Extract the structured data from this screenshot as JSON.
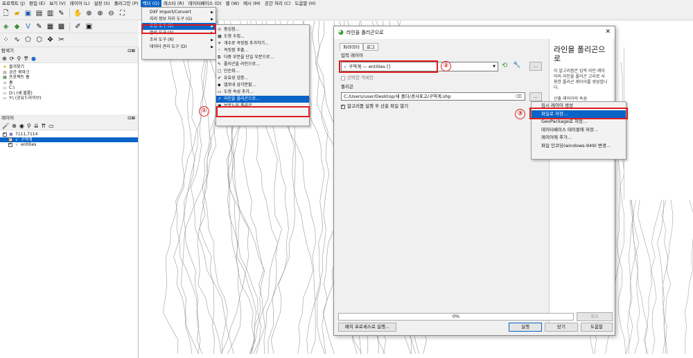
{
  "menubar": [
    "프로젝트 (J)",
    "편집 (E)",
    "보기 (V)",
    "레이어 (L)",
    "설정 (S)",
    "플러그인 (P)",
    "벡터 (O)",
    "래스터 (R)",
    "데이터베이스 (D)",
    "웹 (W)",
    "메시 (M)",
    "공간 처리 (C)",
    "도움말 (H)"
  ],
  "menubar_active_index": 6,
  "vector_menu": {
    "items": [
      {
        "label": "DXF Import/Convert",
        "submenu": true
      },
      {
        "label": "지리 정보 처리 도구 (G)",
        "submenu": true
      },
      {
        "label": "도형 도구 (E)",
        "submenu": true,
        "selected": true
      },
      {
        "label": "분석 도구 (A)",
        "submenu": true
      },
      {
        "label": "조사 도구 (R)",
        "submenu": true
      },
      {
        "label": "데이터 관리 도구 (D)",
        "submenu": true
      }
    ]
  },
  "geometry_menu": {
    "items": [
      {
        "label": "중심점...",
        "icon": "centroid-icon",
        "glyph": "⊙"
      },
      {
        "label": "도형 수집...",
        "icon": "collect-icon",
        "glyph": "▦"
      },
      {
        "label": "개수로 꼭짓점 추가하기...",
        "icon": "densify-icon",
        "glyph": "✳"
      },
      {
        "label": "꼭짓점 추출...",
        "icon": "vertices-icon",
        "glyph": "⁘"
      },
      {
        "label": "다중 부분을 단일 부분으로...",
        "icon": "multipart-icon",
        "glyph": "⧉"
      },
      {
        "label": "폴리곤을 라인으로...",
        "icon": "polygon-to-line-icon",
        "glyph": "✎"
      },
      {
        "label": "단순화...",
        "icon": "simplify-icon",
        "glyph": "▢"
      },
      {
        "label": "유효성 검증...",
        "icon": "check-icon",
        "glyph": "✔"
      },
      {
        "label": "델로네 삼각분할...",
        "icon": "delaunay-icon",
        "glyph": "◆"
      },
      {
        "label": "도형 속성 추가...",
        "icon": "geometry-attr-icon",
        "glyph": "▭"
      },
      {
        "label": "라인을 폴리곤으로...",
        "icon": "line-to-polygon-icon",
        "glyph": "↗",
        "selected": true
      },
      {
        "label": "보로노이 폴리곤...",
        "icon": "voronoi-icon",
        "glyph": "▣"
      }
    ]
  },
  "browser_panel": {
    "title": "탐색기",
    "items": [
      {
        "label": "즐겨찾기",
        "glyph": "★",
        "color": "#e0a800"
      },
      {
        "label": "공간 북마크",
        "glyph": "▤",
        "color": "#777"
      },
      {
        "label": "프로젝트 홈",
        "glyph": "▦",
        "color": "#2b7a2b"
      },
      {
        "label": "홈",
        "glyph": "⌂",
        "color": "#555"
      },
      {
        "label": "C:\\",
        "glyph": "▭",
        "color": "#555"
      },
      {
        "label": "D:\\ (새 볼륨)",
        "glyph": "▭",
        "color": "#555"
      },
      {
        "label": "Y:\\ (공유드라이브)",
        "glyph": "▭",
        "color": "#555"
      }
    ]
  },
  "layers_panel": {
    "title": "레이어",
    "items": [
      {
        "label": "7111,7114",
        "indent": 0,
        "checked": true
      },
      {
        "label": "구역계",
        "indent": 1,
        "checked": true,
        "selected": true
      },
      {
        "label": "entities",
        "indent": 1,
        "checked": true
      }
    ]
  },
  "dialog": {
    "title": "라인을 폴리곤으로",
    "tabs": [
      "파라미터",
      "로그"
    ],
    "input_label": "입력 레이어",
    "input_value": "구역계 — entities []",
    "selected_only": "선택한 객체만",
    "output_label": "폴리곤",
    "output_value": "C:/Users/user/Desktop/새 폴더/경사표고/구역계.shp",
    "open_after": "알고리즘 실행 후 산출 파일 열기",
    "progress": "0%",
    "cancel": "취소",
    "batch": "배치 프로세스로 실행...",
    "run": "실행",
    "close": "닫기",
    "help_btn": "도움말",
    "help_title": "라인을 폴리곤으로",
    "help_text": "이 알고리즘은 입력 라인 레이어의 라인을 폴리곤 고리로 사용한 폴리곤 레이어를 생성합니다.",
    "help_text2": "산출 레이어의 속성"
  },
  "save_menu": {
    "items": [
      {
        "label": "임시 레이어 생성"
      },
      {
        "label": "파일로 저장...",
        "selected": true
      },
      {
        "label": "GeoPackage로 저장..."
      },
      {
        "label": "데이터베이스 테이블에 저장..."
      },
      {
        "label": "레이어에 추가..."
      },
      {
        "label": "파일 인코딩(windows-949) 변경..."
      }
    ]
  },
  "steps": [
    "①",
    "②",
    "③"
  ],
  "colors": {
    "accent": "#0a64c8",
    "highlight": "#e01b1b"
  }
}
